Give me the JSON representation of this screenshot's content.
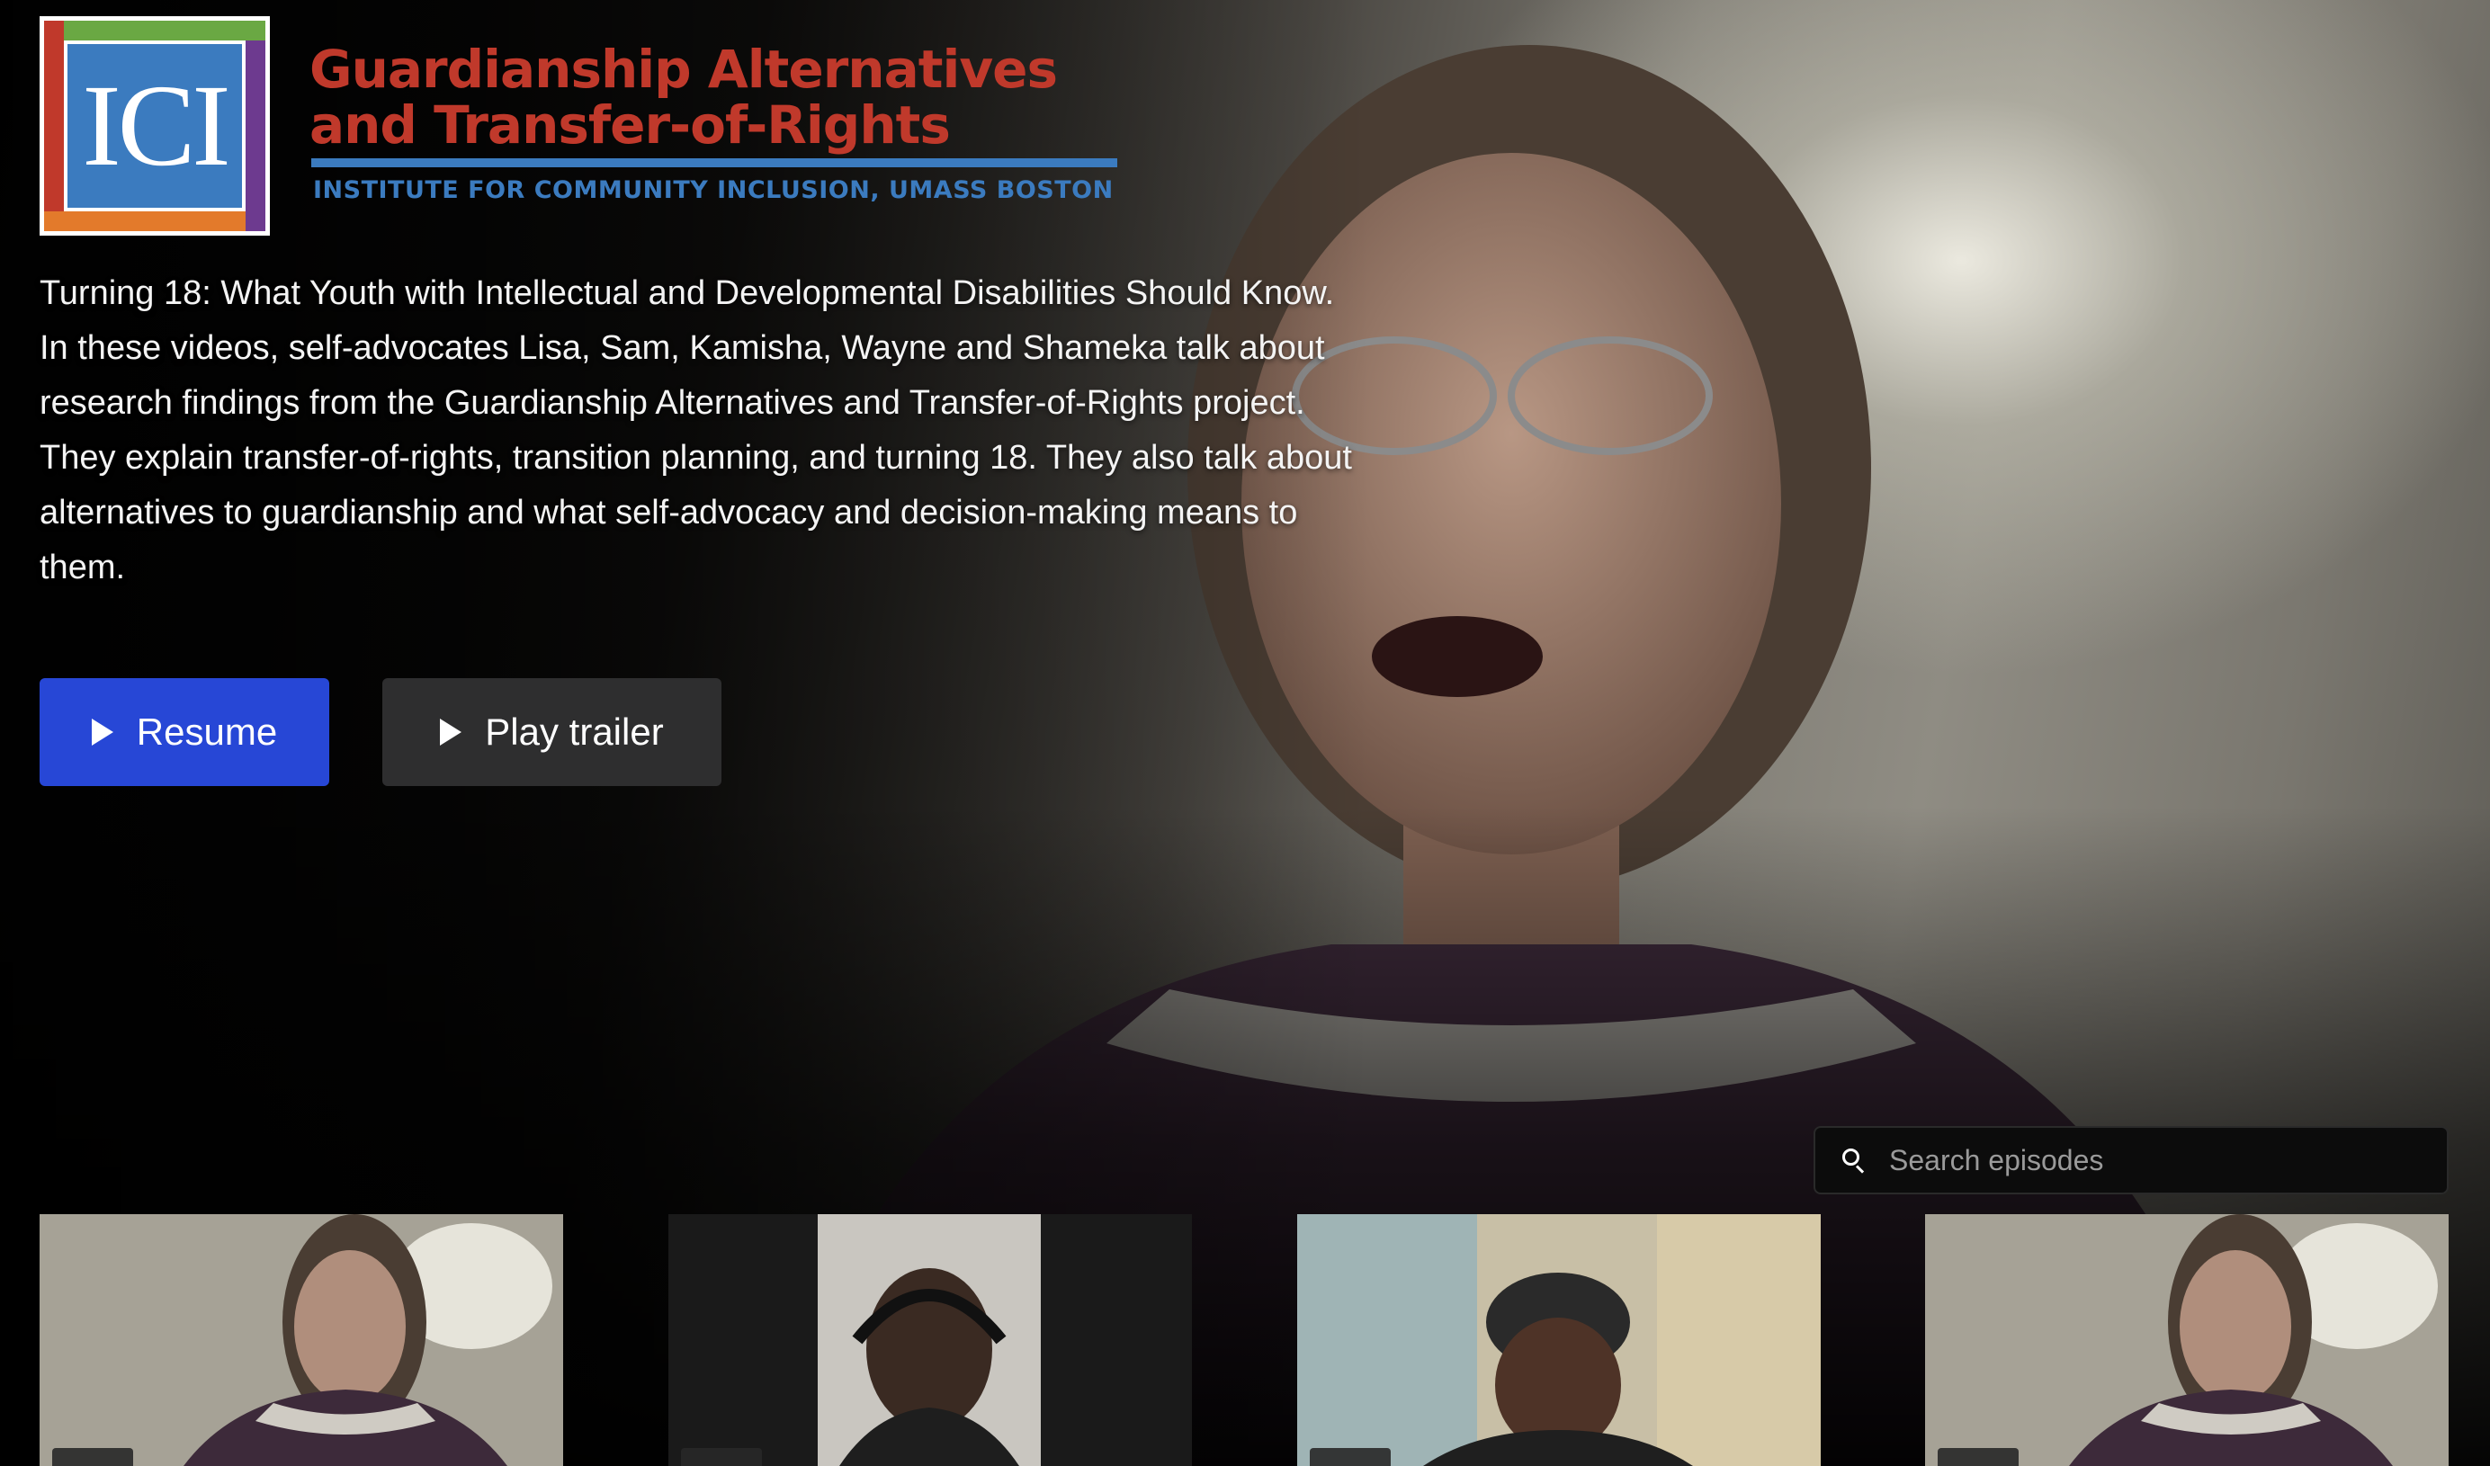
{
  "brand": {
    "mark_text": "ICI",
    "title_line1": "Guardianship Alternatives",
    "title_line2": "and Transfer-of-Rights",
    "subtitle": "INSTITUTE FOR COMMUNITY INCLUSION, UMASS BOSTON",
    "colors": {
      "red": "#c0392b",
      "blue": "#3b7bbf",
      "green": "#6aa843",
      "purple": "#6d3a8f",
      "orange": "#e37a2b"
    }
  },
  "description": "Turning 18: What Youth with Intellectual and Developmental Disabilities Should Know. In these videos, self-advocates Lisa, Sam, Kamisha, Wayne and Shameka talk about research findings from the Guardianship Alternatives and Transfer-of-Rights project. They explain transfer-of-rights, transition planning, and turning 18. They also talk about alternatives to guardianship and what self-advocacy and decision-making means to them.",
  "actions": {
    "resume_label": "Resume",
    "trailer_label": "Play trailer",
    "resume_color": "#2747d6",
    "trailer_color": "#2e2e2f"
  },
  "search": {
    "placeholder": "Search episodes",
    "icon": "search-icon"
  },
  "episodes": [
    {
      "thumbnail": "speaker-woman-glasses"
    },
    {
      "thumbnail": "speaker-man-headphones"
    },
    {
      "thumbnail": "speaker-woman-hat"
    },
    {
      "thumbnail": "speaker-woman-glasses"
    }
  ]
}
